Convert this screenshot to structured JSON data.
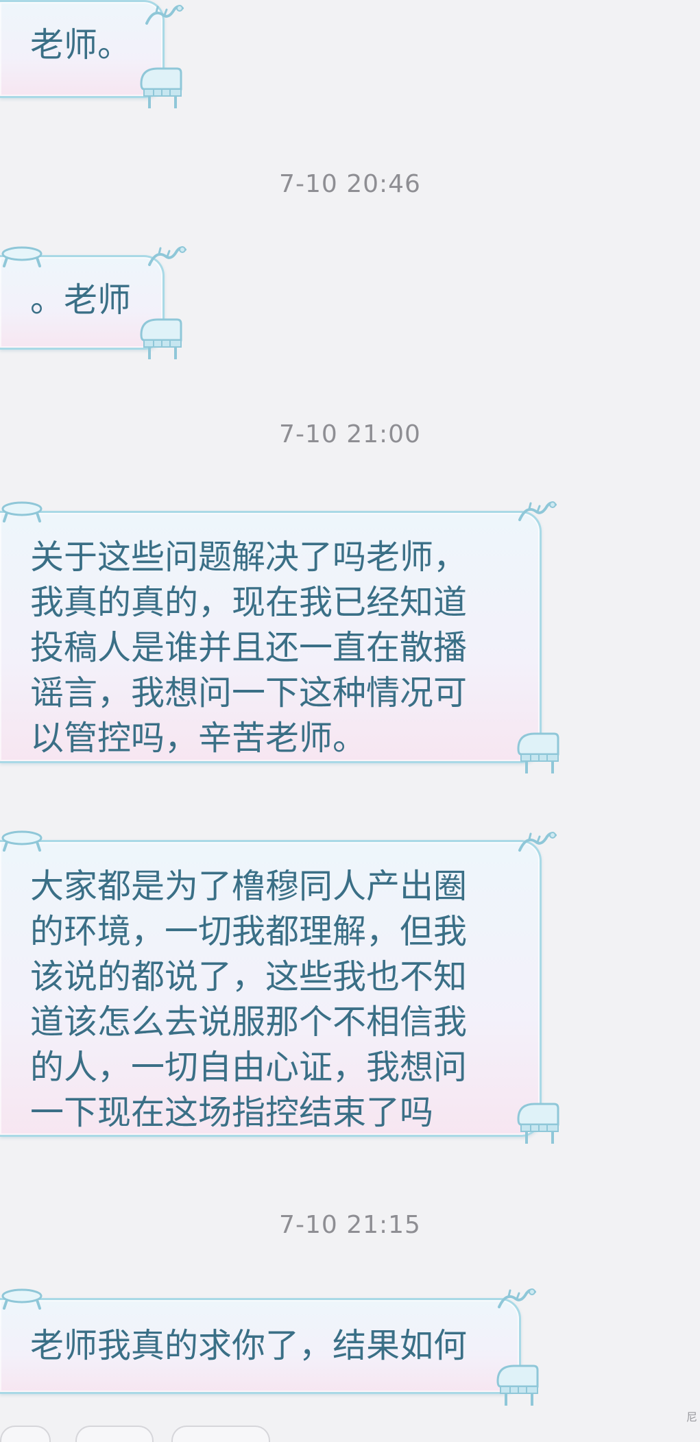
{
  "chat": {
    "timestamps": [
      "7-10 20:46",
      "7-10 21:00",
      "7-10 21:15"
    ],
    "messages": [
      "老师。",
      "。老师",
      "关于这些问题解决了吗老师，\n我真的真的，现在我已经知道\n投稿人是谁并且还一直在散播\n谣言，我想问一下这种情况可\n以管控吗，辛苦老师。",
      "大家都是为了橹穆同人产出圈\n的环境，一切我都理解，但我\n该说的都说了，这些我也不知\n道该怎么去说服那个不相信我\n的人，一切自由心证，我想问\n一下现在这场指控结束了吗",
      "老师我真的求你了，结果如何"
    ]
  },
  "theme": {
    "background": "#f2f2f4",
    "bubble_border": "#a9d9e6",
    "text_color": "#3a6f86",
    "timestamp_color": "#8e8e93"
  },
  "icons": {
    "bubble_top_left": "lounge-chair-icon",
    "bubble_top_right": "dragon-icon",
    "bubble_bottom_right": "piano-icon"
  },
  "footer": {
    "corner_glyph": "尼"
  }
}
